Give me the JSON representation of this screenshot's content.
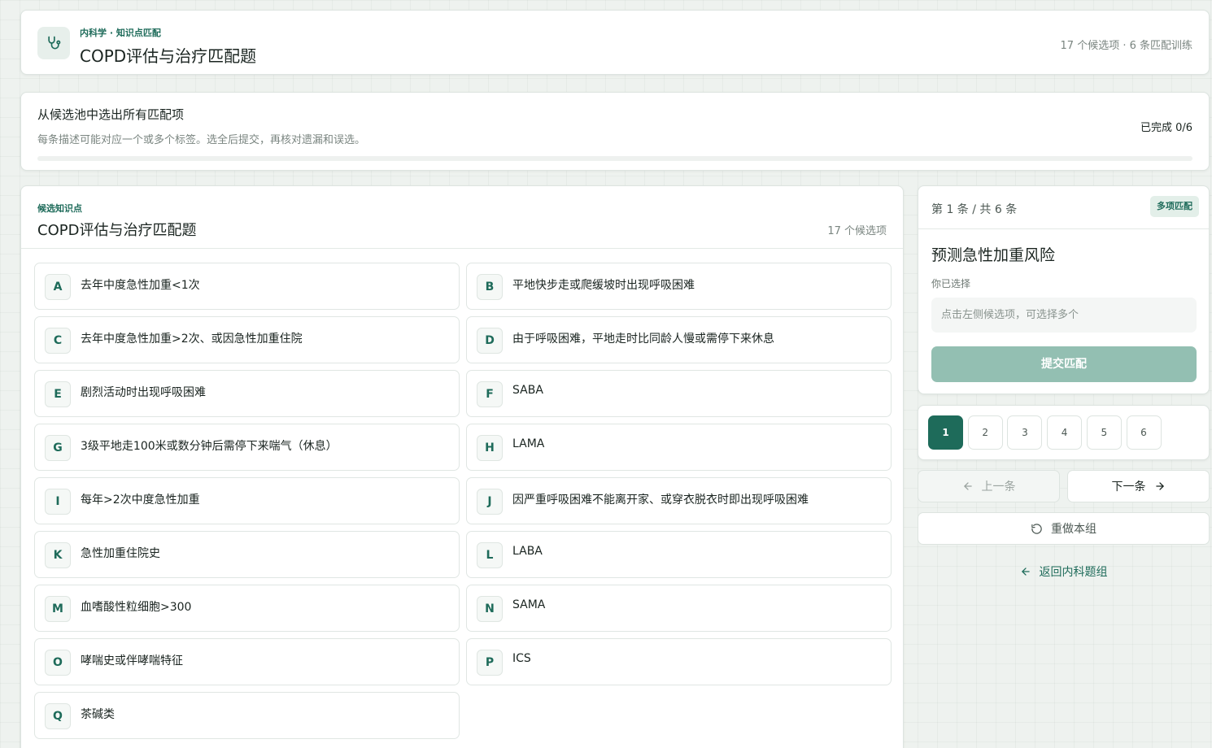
{
  "header": {
    "breadcrumb": "内科学 · 知识点匹配",
    "title": "COPD评估与治疗匹配题",
    "meta": "17 个候选项 · 6 条匹配训练"
  },
  "instructions": {
    "heading": "从候选池中选出所有匹配项",
    "subtitle": "每条描述可能对应一个或多个标签。选全后提交，再核对遗漏和误选。",
    "progress_label": "已完成 0/6",
    "progress_fraction": 0
  },
  "pool": {
    "label": "候选知识点",
    "title": "COPD评估与治疗匹配题",
    "count": "17 个候选项",
    "options": [
      {
        "key": "A",
        "text": "去年中度急性加重<1次"
      },
      {
        "key": "B",
        "text": "平地快步走或爬缓坡时出现呼吸困难"
      },
      {
        "key": "C",
        "text": "去年中度急性加重>2次、或因急性加重住院"
      },
      {
        "key": "D",
        "text": "由于呼吸困难，平地走时比同龄人慢或需停下来休息"
      },
      {
        "key": "E",
        "text": "剧烈活动时出现呼吸困难"
      },
      {
        "key": "F",
        "text": "SABA"
      },
      {
        "key": "G",
        "text": "3级平地走100米或数分钟后需停下来喘气（休息）"
      },
      {
        "key": "H",
        "text": "LAMA"
      },
      {
        "key": "I",
        "text": "每年>2次中度急性加重"
      },
      {
        "key": "J",
        "text": "因严重呼吸困难不能离开家、或穿衣脱衣时即出现呼吸困难"
      },
      {
        "key": "K",
        "text": "急性加重住院史"
      },
      {
        "key": "L",
        "text": "LABA"
      },
      {
        "key": "M",
        "text": "血嗜酸性粒细胞>300"
      },
      {
        "key": "N",
        "text": "SAMA"
      },
      {
        "key": "O",
        "text": "哮喘史或伴哮喘特征"
      },
      {
        "key": "P",
        "text": "ICS"
      },
      {
        "key": "Q",
        "text": "茶碱类"
      }
    ]
  },
  "question": {
    "position": "第 1 条 / 共 6 条",
    "badge": "多项匹配",
    "prompt": "预测急性加重风险",
    "selected_label": "你已选择",
    "selected_placeholder": "点击左侧候选项，可选择多个",
    "submit_label": "提交匹配"
  },
  "pager": {
    "numbers": [
      "1",
      "2",
      "3",
      "4",
      "5",
      "6"
    ],
    "active": "1"
  },
  "nav": {
    "prev_label": "上一条",
    "next_label": "下一条",
    "redo_label": "重做本组",
    "back_label": "返回内科题组"
  },
  "colors": {
    "accent": "#1e6b5a",
    "accent_light": "#e3efe9",
    "submit_disabled": "#93bfb2",
    "background": "#eef2ef"
  },
  "icons": {
    "logo": "stethoscope-icon",
    "prev": "arrow-left-icon",
    "next": "arrow-right-icon",
    "redo": "rotate-ccw-icon",
    "back": "arrow-left-icon"
  }
}
